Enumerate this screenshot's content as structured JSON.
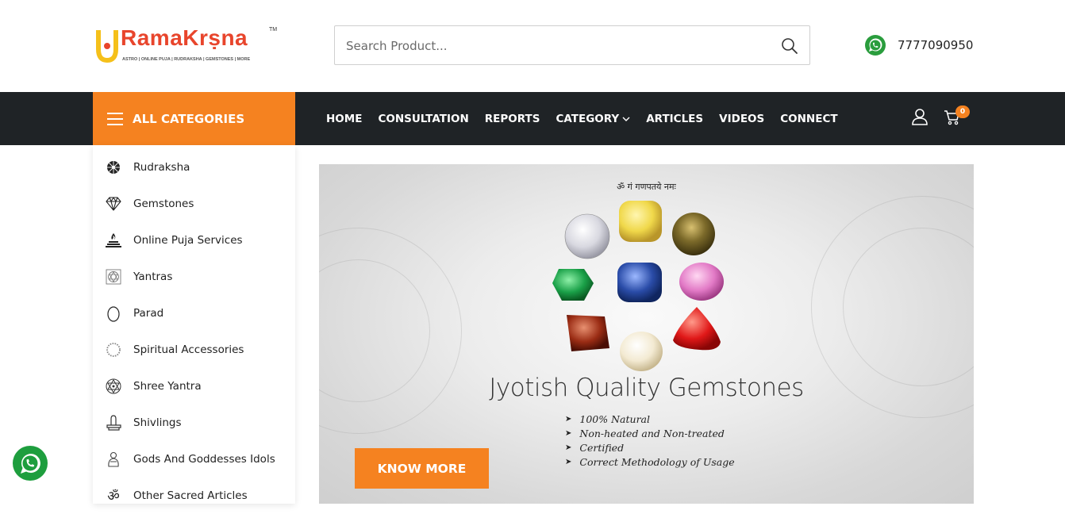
{
  "header": {
    "logo": {
      "name": "RamaKrṣna",
      "tm": "TM",
      "tagline": "ASTRO | ONLINE PUJA | RUDRAKSHA | GEMSTONES | MORE"
    },
    "search": {
      "placeholder": "Search Product..."
    },
    "phone": "7777090950"
  },
  "nav": {
    "all_categories": "ALL CATEGORIES",
    "items": [
      {
        "label": "HOME"
      },
      {
        "label": "CONSULTATION"
      },
      {
        "label": "REPORTS"
      },
      {
        "label": "CATEGORY"
      },
      {
        "label": "ARTICLES"
      },
      {
        "label": "VIDEOS"
      },
      {
        "label": "CONNECT"
      }
    ],
    "cart_count": "0"
  },
  "sidebar": {
    "items": [
      {
        "label": "Rudraksha",
        "icon": "rudraksha-icon"
      },
      {
        "label": "Gemstones",
        "icon": "diamond-icon"
      },
      {
        "label": "Online Puja Services",
        "icon": "puja-fire-icon"
      },
      {
        "label": "Yantras",
        "icon": "yantra-icon"
      },
      {
        "label": "Parad",
        "icon": "egg-icon"
      },
      {
        "label": "Spiritual Accessories",
        "icon": "mala-icon"
      },
      {
        "label": "Shree Yantra",
        "icon": "shree-yantra-icon"
      },
      {
        "label": "Shivlings",
        "icon": "shivling-icon"
      },
      {
        "label": "Gods And Goddesses Idols",
        "icon": "idol-icon"
      },
      {
        "label": "Other Sacred Articles",
        "icon": "om-icon"
      }
    ]
  },
  "banner": {
    "mantra": "ॐ गं गणपतये नमः",
    "headline": "Jyotish Quality Gemstones",
    "bullets": [
      "100% Natural",
      "Non-heated and Non-treated",
      "Certified",
      "Correct Methodology of Usage"
    ],
    "cta": "KNOW MORE"
  },
  "colors": {
    "accent": "#f58220",
    "nav_bg": "#1f2326",
    "logo_red": "#e8452c",
    "whatsapp": "#25d366"
  }
}
